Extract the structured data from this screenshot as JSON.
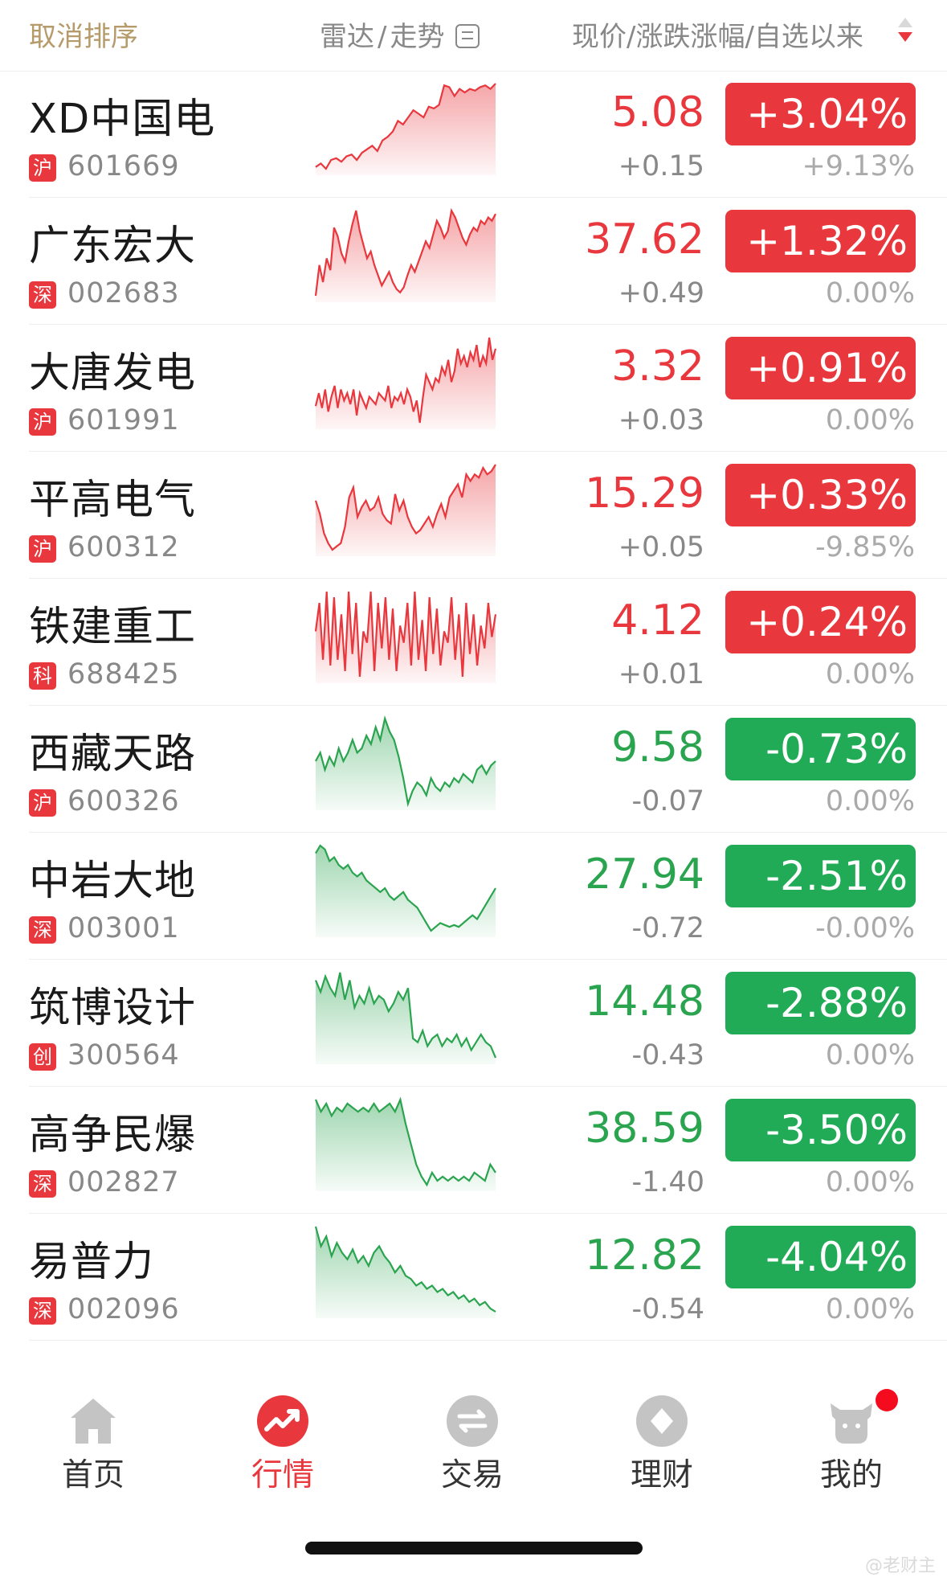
{
  "header": {
    "cancel_sort": "取消排序",
    "radar": "雷达",
    "trend": "走势",
    "price_cols": "现价/涨跌涨幅/自选以来"
  },
  "stocks": [
    {
      "name": "XD中国电",
      "market": "沪",
      "code": "601669",
      "price": "5.08",
      "change": "+0.15",
      "pct": "+3.04%",
      "since": "+9.13%",
      "dir": "up",
      "spark": [
        40,
        42,
        39,
        44,
        45,
        43,
        46,
        47,
        44,
        48,
        50,
        52,
        49,
        55,
        57,
        60,
        66,
        64,
        68,
        72,
        70,
        68,
        74,
        73,
        75,
        86,
        85,
        80,
        84,
        82,
        84,
        83,
        85,
        86,
        84,
        87
      ]
    },
    {
      "name": "广东宏大",
      "market": "深",
      "code": "002683",
      "price": "37.62",
      "change": "+0.49",
      "pct": "+1.32%",
      "since": "0.00%",
      "dir": "up",
      "spark": [
        30,
        48,
        38,
        52,
        45,
        70,
        65,
        55,
        50,
        62,
        72,
        80,
        68,
        60,
        52,
        56,
        48,
        42,
        36,
        40,
        44,
        38,
        34,
        32,
        35,
        42,
        48,
        44,
        50,
        56,
        62,
        58,
        66,
        74,
        70,
        64,
        68,
        80,
        76,
        70,
        64,
        60,
        66,
        70,
        68,
        74,
        72,
        76,
        74,
        78
      ]
    },
    {
      "name": "大唐发电",
      "market": "沪",
      "code": "601991",
      "price": "3.32",
      "change": "+0.03",
      "pct": "+0.91%",
      "since": "0.00%",
      "dir": "up",
      "spark": [
        45,
        52,
        44,
        54,
        42,
        50,
        56,
        44,
        54,
        48,
        52,
        46,
        54,
        40,
        52,
        48,
        44,
        50,
        48,
        46,
        52,
        50,
        48,
        56,
        44,
        50,
        48,
        52,
        46,
        54,
        50,
        42,
        48,
        36,
        50,
        62,
        58,
        54,
        60,
        58,
        66,
        62,
        70,
        58,
        64,
        76,
        68,
        72,
        66,
        74,
        70,
        78,
        66,
        72,
        68,
        82,
        70,
        76
      ]
    },
    {
      "name": "平高电气",
      "market": "沪",
      "code": "600312",
      "price": "15.29",
      "change": "+0.05",
      "pct": "+0.33%",
      "since": "-9.85%",
      "dir": "up",
      "spark": [
        70,
        62,
        50,
        44,
        40,
        42,
        44,
        54,
        72,
        78,
        60,
        66,
        70,
        64,
        66,
        72,
        62,
        58,
        56,
        74,
        64,
        70,
        60,
        54,
        50,
        52,
        56,
        60,
        54,
        62,
        68,
        60,
        72,
        76,
        80,
        72,
        86,
        82,
        86,
        84,
        90,
        86,
        88,
        92
      ]
    },
    {
      "name": "铁建重工",
      "market": "科",
      "code": "688425",
      "price": "4.12",
      "change": "+0.01",
      "pct": "+0.24%",
      "since": "0.00%",
      "dir": "up",
      "spark": [
        60,
        70,
        50,
        74,
        48,
        72,
        50,
        66,
        46,
        74,
        52,
        70,
        44,
        60,
        56,
        74,
        46,
        70,
        54,
        72,
        50,
        68,
        46,
        62,
        56,
        70,
        48,
        74,
        50,
        64,
        46,
        72,
        52,
        68,
        48,
        60,
        56,
        72,
        50,
        66,
        44,
        70,
        52,
        66,
        48,
        62,
        54,
        70,
        58,
        66
      ]
    },
    {
      "name": "西藏天路",
      "market": "沪",
      "code": "600326",
      "price": "9.58",
      "change": "-0.07",
      "pct": "-0.73%",
      "since": "0.00%",
      "dir": "down",
      "spark": [
        60,
        64,
        56,
        62,
        58,
        66,
        60,
        64,
        70,
        64,
        66,
        72,
        68,
        76,
        70,
        80,
        74,
        70,
        62,
        52,
        40,
        46,
        50,
        48,
        44,
        52,
        48,
        46,
        50,
        48,
        52,
        50,
        54,
        52,
        50,
        56,
        58,
        54,
        58,
        60
      ]
    },
    {
      "name": "中岩大地",
      "market": "深",
      "code": "003001",
      "price": "27.94",
      "change": "-0.72",
      "pct": "-2.51%",
      "since": "-0.00%",
      "dir": "down",
      "spark": [
        70,
        74,
        72,
        66,
        68,
        64,
        62,
        64,
        60,
        58,
        60,
        56,
        54,
        52,
        50,
        52,
        48,
        46,
        48,
        50,
        46,
        44,
        42,
        38,
        34,
        30,
        32,
        34,
        33,
        32,
        33,
        32,
        34,
        36,
        38,
        36,
        40,
        44,
        48,
        52
      ]
    },
    {
      "name": "筑博设计",
      "market": "创",
      "code": "300564",
      "price": "14.48",
      "change": "-0.43",
      "pct": "-2.88%",
      "since": "0.00%",
      "dir": "down",
      "spark": [
        70,
        64,
        72,
        66,
        62,
        74,
        60,
        70,
        56,
        62,
        58,
        66,
        58,
        62,
        60,
        54,
        58,
        64,
        60,
        66,
        40,
        38,
        44,
        36,
        40,
        42,
        36,
        40,
        38,
        42,
        36,
        40,
        34,
        38,
        42,
        38,
        36,
        30
      ]
    },
    {
      "name": "高争民爆",
      "market": "深",
      "code": "002827",
      "price": "38.59",
      "change": "-1.40",
      "pct": "-3.50%",
      "since": "0.00%",
      "dir": "down",
      "spark": [
        82,
        76,
        80,
        74,
        78,
        76,
        80,
        78,
        76,
        78,
        76,
        80,
        76,
        78,
        80,
        76,
        82,
        70,
        60,
        50,
        44,
        40,
        46,
        42,
        44,
        42,
        44,
        42,
        44,
        42,
        46,
        44,
        42,
        50,
        46
      ]
    },
    {
      "name": "易普力",
      "market": "深",
      "code": "002096",
      "price": "12.82",
      "change": "-0.54",
      "pct": "-4.04%",
      "since": "0.00%",
      "dir": "down",
      "spark": [
        84,
        72,
        78,
        66,
        74,
        68,
        64,
        70,
        62,
        66,
        60,
        68,
        72,
        66,
        62,
        56,
        60,
        54,
        52,
        48,
        50,
        46,
        48,
        44,
        46,
        42,
        44,
        40,
        42,
        38,
        40,
        36,
        38,
        34,
        32
      ]
    }
  ],
  "tabs": [
    {
      "label": "首页",
      "icon": "home-icon"
    },
    {
      "label": "行情",
      "icon": "market-trend-icon"
    },
    {
      "label": "交易",
      "icon": "trade-exchange-icon"
    },
    {
      "label": "理财",
      "icon": "wealth-diamond-icon"
    },
    {
      "label": "我的",
      "icon": "profile-bull-icon"
    }
  ],
  "colors": {
    "up": "#e8373d",
    "down": "#2aa44f",
    "active_tab": "#e8373d"
  },
  "watermark": "@老财主"
}
